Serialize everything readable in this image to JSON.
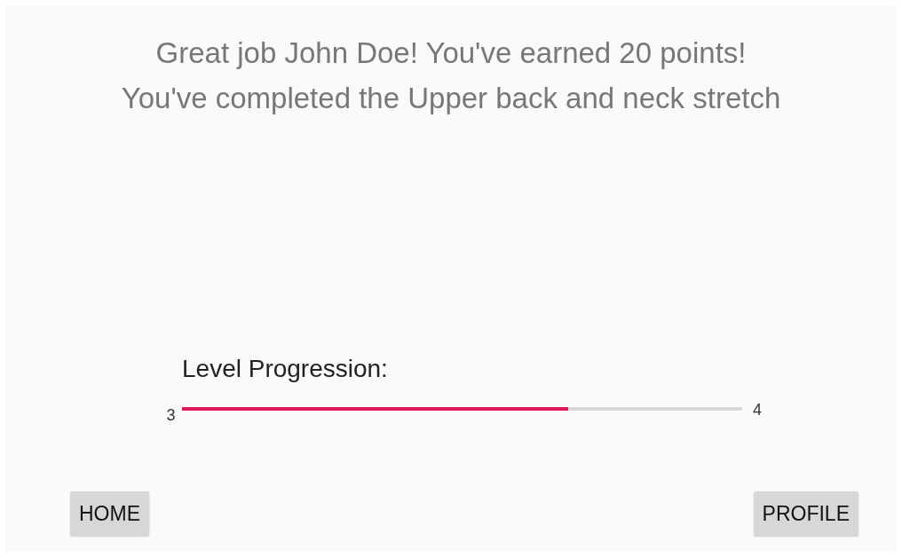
{
  "message": {
    "lines": [
      "Great job John Doe! You've earned 20 points!",
      "You've completed the Upper back and neck stretch"
    ]
  },
  "progression": {
    "label": "Level Progression:",
    "from": "3",
    "to": "4",
    "level": 0.69
  },
  "buttons": [
    {
      "label": "HOME"
    },
    {
      "label": "PROFILE"
    }
  ]
}
